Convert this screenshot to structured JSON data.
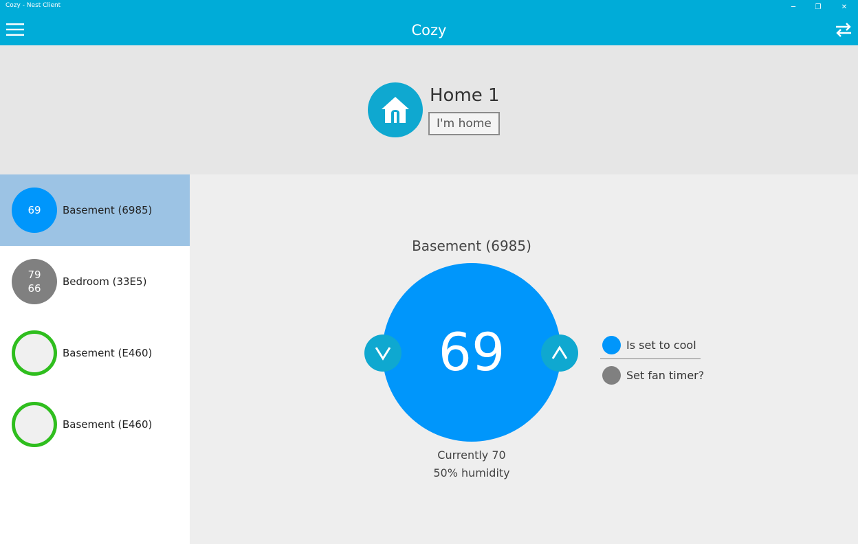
{
  "window": {
    "title": "Cozy - Nest Client",
    "minimize": "─",
    "restore": "❐",
    "close": "✕"
  },
  "appbar": {
    "title": "Cozy",
    "menu_icon": "hamburger-icon",
    "switch_icon": "swap-arrows-icon"
  },
  "colors": {
    "accent": "#00acd8",
    "dial_blue": "#0096fb",
    "eco_green": "#2fbe1e",
    "selected_row": "#9cc3e4",
    "fan_grey": "#808080"
  },
  "structure": {
    "icon": "house-icon",
    "name": "Home 1",
    "away_button": "I'm home"
  },
  "thermostats": [
    {
      "badge_line1": "69",
      "badge_line2": "",
      "label": "Basement (6985)",
      "badge_style": "blue",
      "selected": true
    },
    {
      "badge_line1": "79",
      "badge_line2": "66",
      "label": "Bedroom (33E5)",
      "badge_style": "grey",
      "selected": false
    },
    {
      "badge_line1": "",
      "badge_line2": "",
      "label": "Basement (E460)",
      "badge_style": "green-ring",
      "selected": false
    },
    {
      "badge_line1": "",
      "badge_line2": "",
      "label": "Basement (E460)",
      "badge_style": "green-ring",
      "selected": false
    }
  ],
  "detail": {
    "device_name": "Basement (6985)",
    "target_temperature": "69",
    "decrease_icon": "chevron-down-icon",
    "increase_icon": "chevron-up-icon",
    "current_temperature": "Currently 70",
    "humidity": "50% humidity",
    "modes": [
      {
        "label": "Is set to cool",
        "color": "#0096fb"
      },
      {
        "label": "Set fan timer?",
        "color": "#808080"
      }
    ]
  }
}
